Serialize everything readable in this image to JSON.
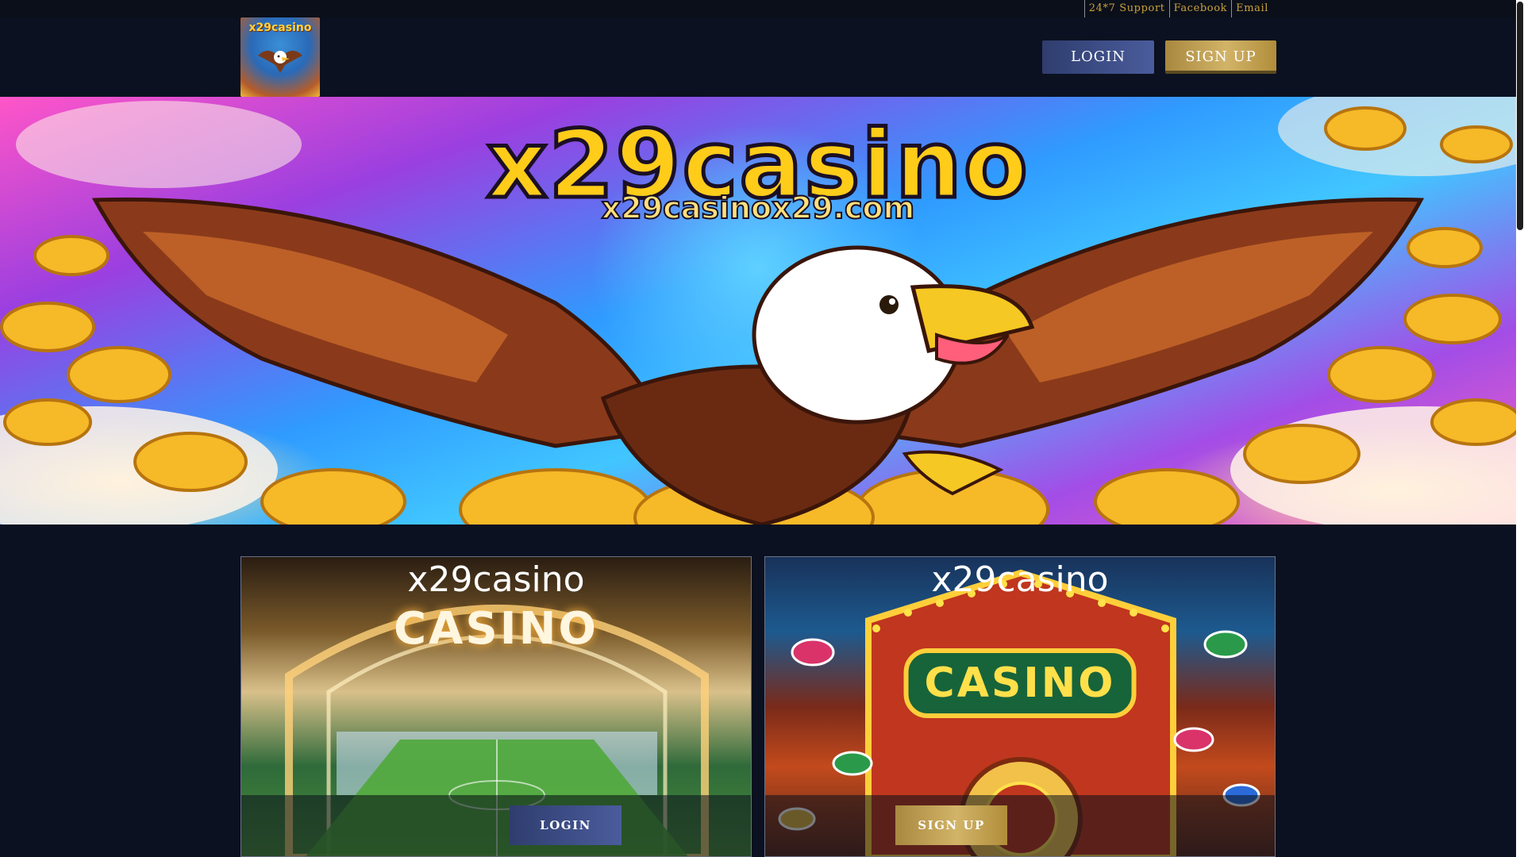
{
  "topbar": {
    "links": [
      {
        "label": "24*7 Support"
      },
      {
        "label": "Facebook"
      },
      {
        "label": "Email"
      }
    ]
  },
  "header": {
    "logo_text": "x29casino",
    "login_label": "LOGIN",
    "signup_label": "SIGN UP"
  },
  "hero": {
    "title": "x29casino",
    "subtitle": "x29casinox29.com"
  },
  "cards": [
    {
      "title": "x29casino",
      "sign": "CASINO",
      "button": "LOGIN"
    },
    {
      "title": "x29casino",
      "sign": "CASINO",
      "button": "SIGN UP"
    }
  ],
  "colors": {
    "background": "#0b1120",
    "accent_gold": "#c9a13b",
    "login_blue": "#3a4a85",
    "signup_gold": "#c9a85a"
  }
}
